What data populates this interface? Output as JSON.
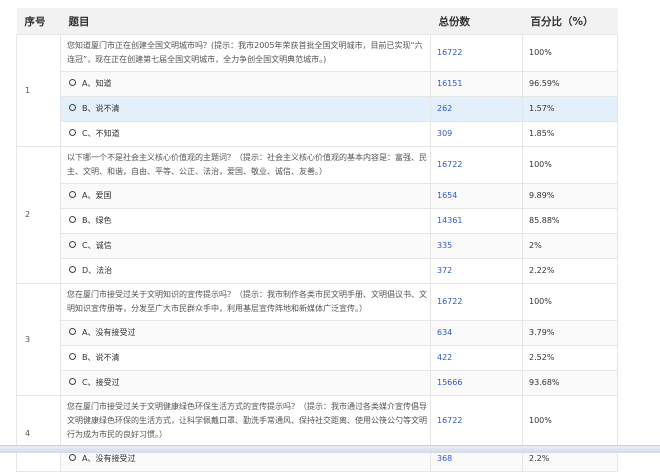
{
  "headers": {
    "seq": "序号",
    "question": "题目",
    "total": "总份数",
    "percent": "百分比（%）"
  },
  "questions": [
    {
      "seq": "1",
      "text": "您知道厦门市正在创建全国文明城市吗？(提示：我市2005年荣获首批全国文明城市，目前已实现“六连冠”，现在正在创建第七届全国文明城市，全力争创全国文明典范城市。)",
      "total": "16722",
      "percent": "100%",
      "options": [
        {
          "label": "A、知道",
          "count": "16151",
          "percent": "96.59%"
        },
        {
          "label": "B、说不清",
          "count": "262",
          "percent": "1.57%"
        },
        {
          "label": "C、不知道",
          "count": "309",
          "percent": "1.85%"
        }
      ]
    },
    {
      "seq": "2",
      "text": "以下哪一个不是社会主义核心价值观的主题词？（提示：社会主义核心价值观的基本内容是：富强、民主、文明、和谐，自由、平等、公正、法治，爱国、敬业、诚信、友善。）",
      "total": "16722",
      "percent": "100%",
      "options": [
        {
          "label": "A、爱国",
          "count": "1654",
          "percent": "9.89%"
        },
        {
          "label": "B、绿色",
          "count": "14361",
          "percent": "85.88%"
        },
        {
          "label": "C、诚信",
          "count": "335",
          "percent": "2%"
        },
        {
          "label": "D、法治",
          "count": "372",
          "percent": "2.22%"
        }
      ]
    },
    {
      "seq": "3",
      "text": "您在厦门市接受过关于文明知识的宣传提示吗？（提示：我市制作各类市民文明手册、文明倡议书、文明知识宣传册等，分发至广大市民群众手中，利用基层宣传阵地和新媒体广泛宣传。）",
      "total": "16722",
      "percent": "100%",
      "options": [
        {
          "label": "A、没有接受过",
          "count": "634",
          "percent": "3.79%"
        },
        {
          "label": "B、说不清",
          "count": "422",
          "percent": "2.52%"
        },
        {
          "label": "C、接受过",
          "count": "15666",
          "percent": "93.68%"
        }
      ]
    },
    {
      "seq": "4",
      "text": "您在厦门市接受过关于文明健康绿色环保生活方式的宣传提示吗？（提示：我市通过各类媒介宣传倡导文明健康绿色环保的生活方式，让科学佩戴口罩、勤洗手常通风、保持社交距离、使用公筷公勺等文明行为成为市民的良好习惯。）",
      "total": "16722",
      "percent": "100%",
      "options": [
        {
          "label": "A、没有接受过",
          "count": "368",
          "percent": "2.2%"
        }
      ]
    }
  ]
}
